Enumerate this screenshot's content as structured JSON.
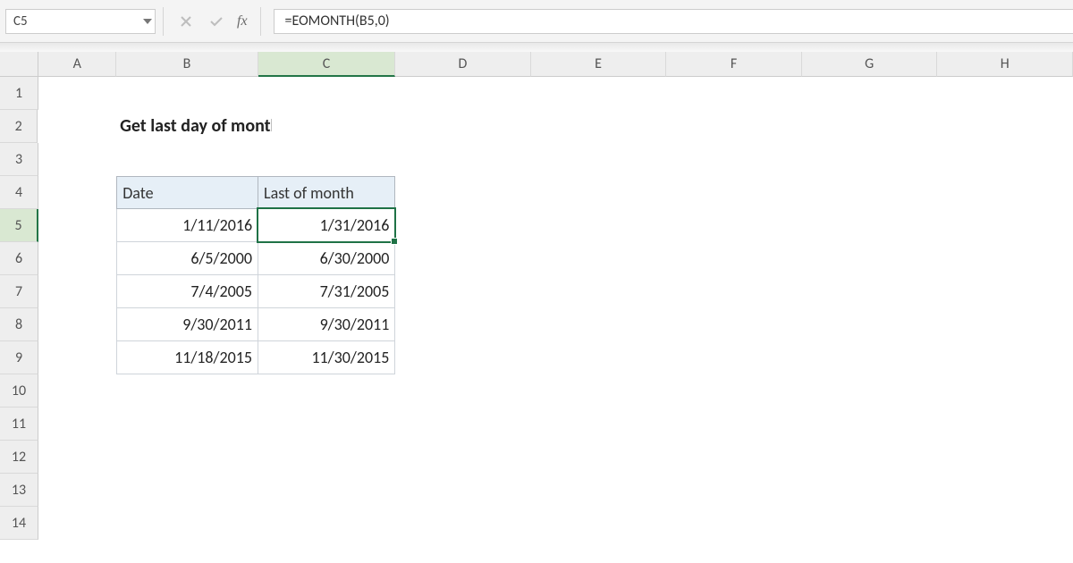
{
  "namebox": {
    "value": "C5"
  },
  "formula_bar": {
    "value": "=EOMONTH(B5,0)"
  },
  "columns": [
    "A",
    "B",
    "C",
    "D",
    "E",
    "F",
    "G",
    "H"
  ],
  "row_numbers": [
    1,
    2,
    3,
    4,
    5,
    6,
    7,
    8,
    9,
    10,
    11,
    12,
    13,
    14
  ],
  "selected_col": "C",
  "selected_row": 5,
  "title": "Get last day of month",
  "table": {
    "headers": {
      "date": "Date",
      "last": "Last of month"
    },
    "rows": [
      {
        "date": "1/11/2016",
        "last": "1/31/2016"
      },
      {
        "date": "6/5/2000",
        "last": "6/30/2000"
      },
      {
        "date": "7/4/2005",
        "last": "7/31/2005"
      },
      {
        "date": "9/30/2011",
        "last": "9/30/2011"
      },
      {
        "date": "11/18/2015",
        "last": "11/30/2015"
      }
    ]
  },
  "icons": {
    "cancel": "cancel-icon",
    "enter": "check-icon",
    "fx": "fx"
  }
}
